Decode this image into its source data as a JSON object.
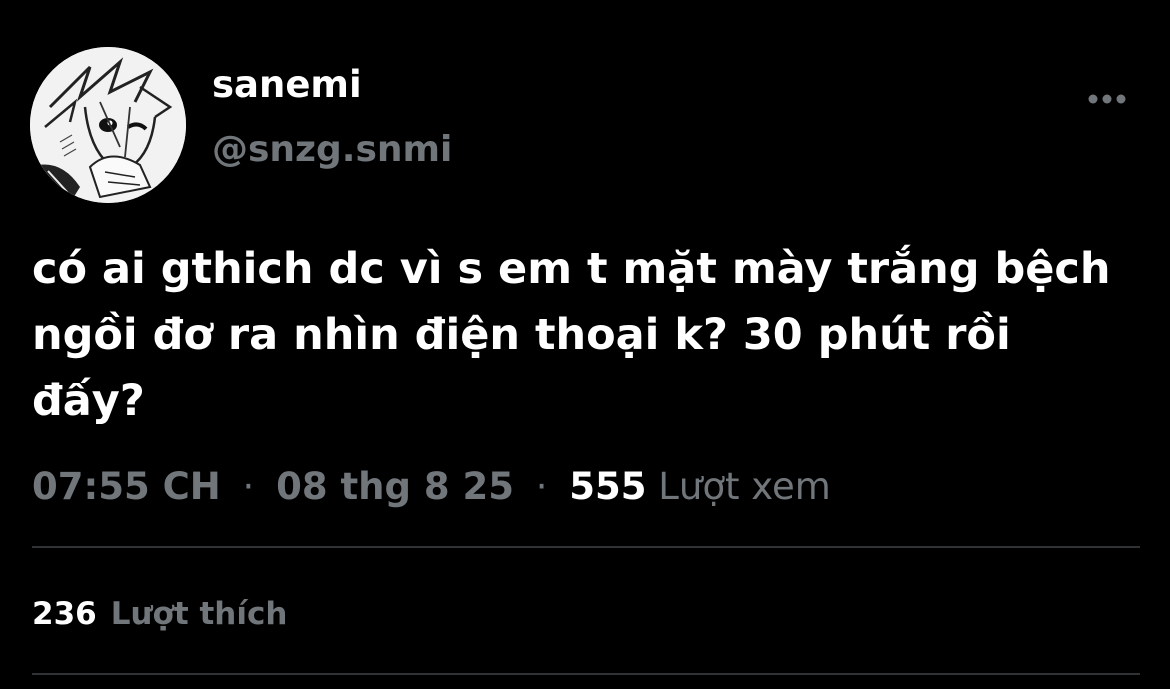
{
  "author": {
    "display_name": "sanemi",
    "handle": "@snzg.snmi",
    "avatar": "anime-character-avatar"
  },
  "actions": {
    "more_icon": "more-horizontal-icon"
  },
  "tweet": {
    "text": "có ai gthich dc vì s em t mặt mày trắng bệch ngồi đơ ra nhìn điện thoại k? 30 phút rồi đấy?"
  },
  "meta": {
    "time": "07:55 CH",
    "date": "08 thg 8 25",
    "separator": "·",
    "views_count": "555",
    "views_label": "Lượt xem"
  },
  "stats": {
    "likes_count": "236",
    "likes_label": "Lượt thích"
  },
  "colors": {
    "background": "#000000",
    "primary_text": "#ffffff",
    "secondary_text": "#71767b",
    "divider": "#2f3336"
  }
}
